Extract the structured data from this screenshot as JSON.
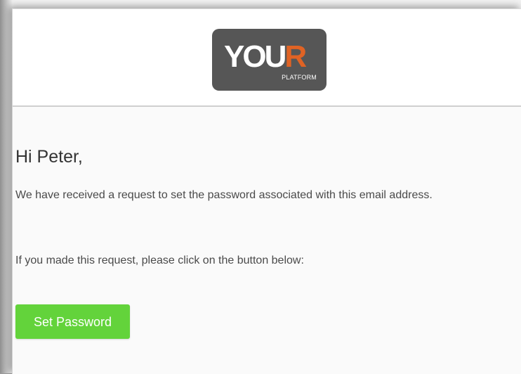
{
  "brand": {
    "logo_main": "YOU",
    "logo_accent": "R",
    "logo_sub": "PLATFORM",
    "colors": {
      "logo_background": "#565656",
      "logo_accent": "#e06324",
      "button": "#63d33b"
    }
  },
  "email": {
    "greeting": "Hi Peter,",
    "message": "We have received a request to set the password associated with this email address.",
    "instruction": "If you made this request, please click on the button below:",
    "button_label": "Set Password"
  }
}
